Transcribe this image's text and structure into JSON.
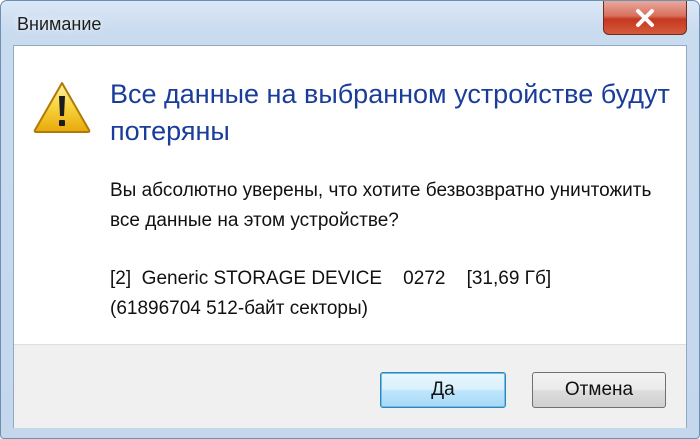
{
  "window": {
    "title": "Внимание"
  },
  "dialog": {
    "icon": "warning-icon",
    "main_instruction": "Все данные на выбранном устройстве будут потеряны",
    "body_text": "Вы абсолютно уверены, что хотите безвозвратно уничтожить все данные на этом устройстве?",
    "device_line1": "[2]  Generic STORAGE DEVICE    0272    [31,69 Гб]",
    "device_line2": "(61896704 512-байт секторы)"
  },
  "buttons": {
    "ok_label": "Да",
    "cancel_label": "Отмена"
  },
  "colors": {
    "instruction_text": "#1a3d9a",
    "close_button": "#c4391f",
    "frame": "#c4d7ed"
  }
}
